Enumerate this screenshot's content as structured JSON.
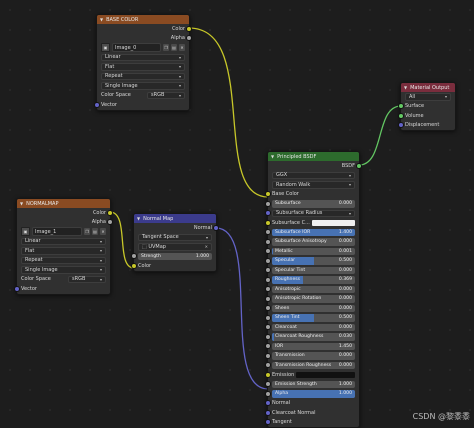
{
  "colors": {
    "background": "#1d1d1d",
    "texture_header": "#8a4b22",
    "vector_header": "#3b3b8c",
    "shader_header": "#2d6b2d",
    "output_header": "#7a2d3d",
    "color_socket": "#c7c729",
    "float_socket": "#a1a1a1",
    "vector_socket": "#6363c7",
    "shader_socket": "#63c763",
    "value_fill": "#4772b3"
  },
  "base_color_node": {
    "title": "BASE COLOR",
    "outputs": [
      "Color",
      "Alpha"
    ],
    "image_name": "Image_0",
    "interpolation": "Linear",
    "projection": "Flat",
    "extension": "Repeat",
    "source": "Single Image",
    "color_space_label": "Color Space",
    "color_space_value": "sRGB",
    "input_vector": "Vector"
  },
  "normalmap_tex_node": {
    "title": "NORMALMAP",
    "outputs": [
      "Color",
      "Alpha"
    ],
    "image_name": "Image_1",
    "interpolation": "Linear",
    "projection": "Flat",
    "extension": "Repeat",
    "source": "Single Image",
    "color_space_label": "Color Space",
    "color_space_value": "sRGB",
    "input_vector": "Vector"
  },
  "normal_map_node": {
    "title": "Normal Map",
    "output": "Normal",
    "space": "Tangent Space",
    "uvmap": "UVMap",
    "strength_label": "Strength",
    "strength_value": "1.000",
    "input_color": "Color"
  },
  "principled_node": {
    "title": "Principled BSDF",
    "output": "BSDF",
    "distribution": "GGX",
    "subsurface_method": "Random Walk",
    "base_color": "Base Color",
    "rows": [
      {
        "label": "Subsurface",
        "value": "0.000",
        "fill": 0,
        "sock": "gray"
      },
      {
        "label": "Subsurface Radius",
        "value": "",
        "fill": 0,
        "sock": "blue",
        "kind": "dd"
      },
      {
        "label": "Subsurface C...",
        "value": "",
        "fill": 0,
        "sock": "yellow",
        "kind": "swatch"
      },
      {
        "label": "Subsurface IOR",
        "value": "1.400",
        "fill": 1,
        "sock": "gray"
      },
      {
        "label": "Subsurface Anisotropy",
        "value": "0.000",
        "fill": 0,
        "sock": "gray"
      },
      {
        "label": "Metallic",
        "value": "0.001",
        "fill": 0.001,
        "sock": "gray"
      },
      {
        "label": "Specular",
        "value": "0.500",
        "fill": 0.5,
        "sock": "gray"
      },
      {
        "label": "Specular Tint",
        "value": "0.000",
        "fill": 0,
        "sock": "gray"
      },
      {
        "label": "Roughness",
        "value": "0.369",
        "fill": 0.369,
        "sock": "gray"
      },
      {
        "label": "Anisotropic",
        "value": "0.000",
        "fill": 0,
        "sock": "gray"
      },
      {
        "label": "Anisotropic Rotation",
        "value": "0.000",
        "fill": 0,
        "sock": "gray"
      },
      {
        "label": "Sheen",
        "value": "0.000",
        "fill": 0,
        "sock": "gray"
      },
      {
        "label": "Sheen Tint",
        "value": "0.500",
        "fill": 0.5,
        "sock": "gray"
      },
      {
        "label": "Clearcoat",
        "value": "0.000",
        "fill": 0,
        "sock": "gray"
      },
      {
        "label": "Clearcoat Roughness",
        "value": "0.030",
        "fill": 0.03,
        "sock": "gray"
      },
      {
        "label": "IOR",
        "value": "1.450",
        "fill": 0,
        "sock": "gray"
      },
      {
        "label": "Transmission",
        "value": "0.000",
        "fill": 0,
        "sock": "gray"
      },
      {
        "label": "Transmission Roughness",
        "value": "0.000",
        "fill": 0,
        "sock": "gray"
      },
      {
        "label": "Emission",
        "value": "",
        "fill": 0,
        "sock": "yellow",
        "kind": "swatch-dark"
      },
      {
        "label": "Emission Strength",
        "value": "1.000",
        "fill": 0,
        "sock": "gray"
      },
      {
        "label": "Alpha",
        "value": "1.000",
        "fill": 1,
        "sock": "gray"
      }
    ],
    "bottom_inputs": [
      "Normal",
      "Clearcoat Normal",
      "Tangent"
    ]
  },
  "material_output_node": {
    "title": "Material Output",
    "target": "All",
    "inputs": [
      "Surface",
      "Volume",
      "Displacement"
    ]
  },
  "watermark": "CSDN @黎黍黍"
}
